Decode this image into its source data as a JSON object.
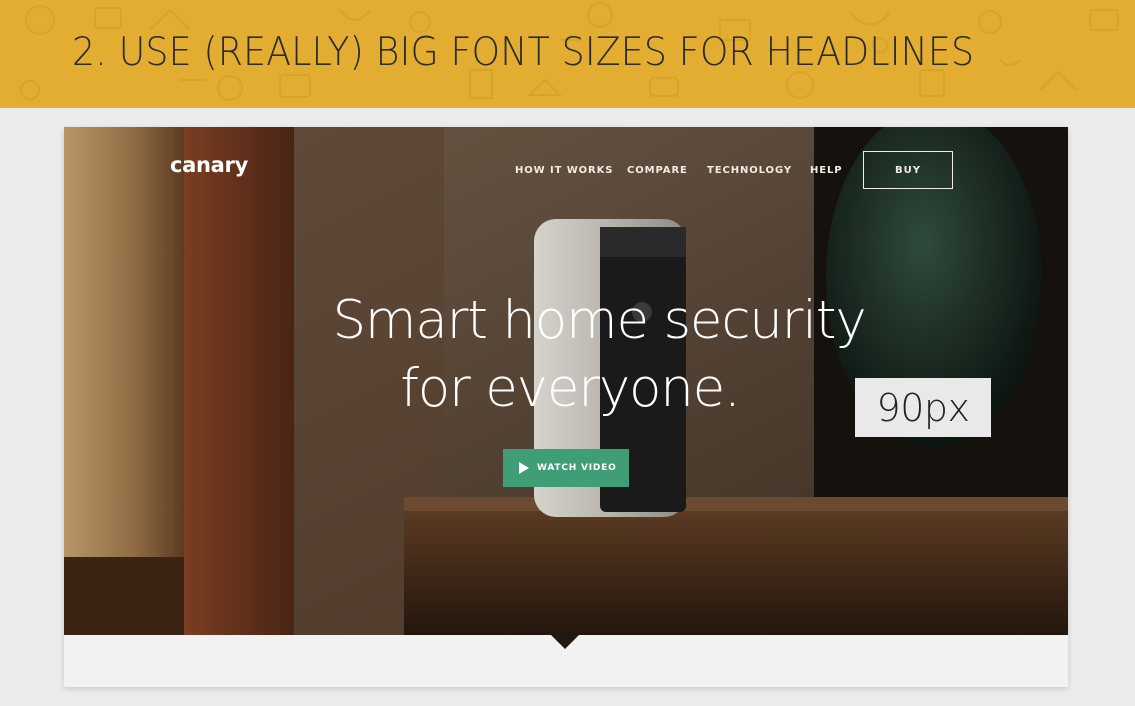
{
  "slide": {
    "title": "2. USE (REALLY) BIG FONT SIZES FOR HEADLINES",
    "background_color": "#e3ad32"
  },
  "site": {
    "logo": "canary",
    "nav": [
      "HOW IT WORKS",
      "COMPARE",
      "TECHNOLOGY",
      "HELP"
    ],
    "buy_label": "BUY",
    "headline_line1": "Smart home security",
    "headline_line2": "for everyone.",
    "watch_label": "WATCH VIDEO",
    "accent_color": "#3f9e76"
  },
  "annotation": {
    "size_label": "90px"
  }
}
